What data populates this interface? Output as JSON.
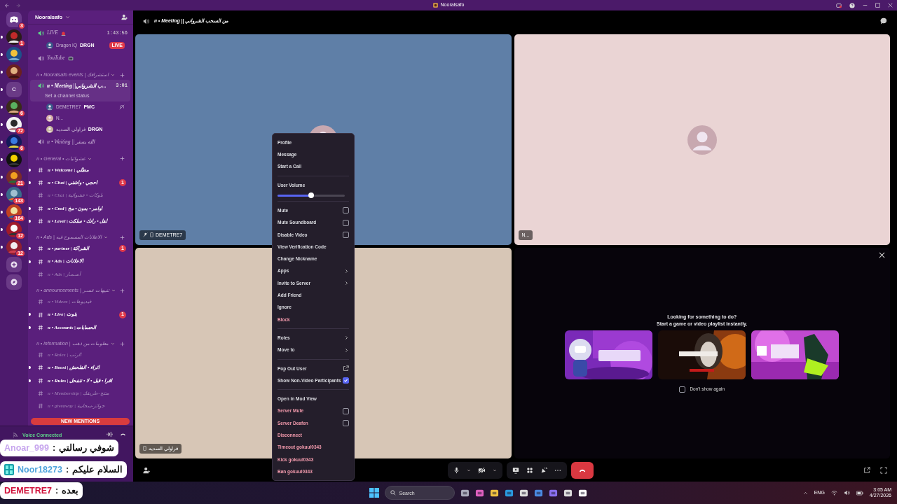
{
  "window": {
    "title": "Nooralsafo"
  },
  "servers": [
    {
      "kind": "home",
      "badge": "3",
      "unread": false
    },
    {
      "kind": "picture",
      "badge": "1",
      "unread": true
    },
    {
      "kind": "picture",
      "unread": true
    },
    {
      "kind": "picture",
      "unread": true
    },
    {
      "kind": "letter",
      "letter": "C",
      "unread": true
    },
    {
      "kind": "picture",
      "badge": "6",
      "unread": true
    },
    {
      "kind": "picture",
      "badge": "72",
      "unread": true
    },
    {
      "kind": "picture",
      "badge": "6",
      "unread": true
    },
    {
      "kind": "picture",
      "unread": true
    },
    {
      "kind": "picture",
      "badge": "21",
      "unread": true
    },
    {
      "kind": "picture",
      "badge": "143",
      "unread": true
    },
    {
      "kind": "picture",
      "badge": "164",
      "unread": true
    },
    {
      "kind": "picture",
      "badge": "12",
      "unread": true
    },
    {
      "kind": "picture",
      "badge": "12",
      "unread": true
    },
    {
      "kind": "add"
    },
    {
      "kind": "discover"
    }
  ],
  "sidebar": {
    "title": "Nooralsafo",
    "channels": [
      {
        "kind": "voice",
        "name": "LIVE",
        "active": true,
        "selected": false,
        "time": "1:43:56",
        "members": [
          {
            "name": "Dragon IQ",
            "tag": "DRGN",
            "live": "LIVE",
            "deafened": false
          }
        ]
      },
      {
        "kind": "voice",
        "name": "YouTube",
        "active": false,
        "selected": false
      },
      {
        "kind": "category",
        "name": "ıı • Nooralsafo events | استشراقك"
      },
      {
        "kind": "voice",
        "name": "ıı • Meeting ||ب الشرواني...",
        "active": true,
        "selected": true,
        "time": "3:01",
        "status": "Set a channel status",
        "members": [
          {
            "name": "DEMETRE7",
            "tag": "PMC",
            "deafened": true
          },
          {
            "name": "N...",
            "deafened": false
          },
          {
            "name": "فراولي السديه",
            "tag": "DRGN",
            "deafened": false
          }
        ]
      },
      {
        "kind": "voice",
        "name": "ıı • Waiting || الله يستر",
        "active": false,
        "selected": false
      },
      {
        "kind": "category",
        "name": "ıı • General • عشوائيات"
      },
      {
        "kind": "text",
        "name": "ıı • Welcome | مطلي",
        "unread": true,
        "selected": false
      },
      {
        "kind": "text",
        "name": "ıı • Chat | احجي • واشتي",
        "unread": true,
        "selected": false,
        "badge": "1"
      },
      {
        "kind": "text",
        "name": "ıı • Chat | بلوكات • عشوائية",
        "unread": false,
        "selected": false
      },
      {
        "kind": "text",
        "name": "ıı • Cmd | اوامر • بدون • مخ",
        "unread": true,
        "selected": false
      },
      {
        "kind": "text",
        "name": "ıı • Level | لفل • رانك • سلكت",
        "unread": true,
        "selected": false
      },
      {
        "kind": "category",
        "name": "ıı • Ads | الاعلانات المسموح فيه"
      },
      {
        "kind": "text",
        "name": "ıı • partner | الشراكة",
        "unread": true,
        "selected": false,
        "badge": "1"
      },
      {
        "kind": "text",
        "name": "ıı • Ads | الاعلانات",
        "unread": true,
        "selected": false
      },
      {
        "kind": "text",
        "name": "ıı • Ads | أسـمـار",
        "unread": false,
        "selected": false
      },
      {
        "kind": "category",
        "name": "ıı • announcements | تنبيهات عسـر"
      },
      {
        "kind": "text",
        "name": "ıı • Videos | فيديوهات",
        "unread": false,
        "selected": false
      },
      {
        "kind": "text",
        "name": "ıı • Live | بثوث",
        "unread": true,
        "selected": false,
        "badge": "1"
      },
      {
        "kind": "text",
        "name": "ıı • Accounts | الحسابات",
        "unread": true,
        "selected": false
      },
      {
        "kind": "category",
        "name": "ıı • information | معلومات من ذهب"
      },
      {
        "kind": "text",
        "name": "ıı • Roles | الرتب",
        "unread": false,
        "selected": false
      },
      {
        "kind": "text",
        "name": "ıı • Boost | اثراء • الفلحش",
        "unread": true,
        "selected": false
      },
      {
        "kind": "text",
        "name": "ıı • Rules | اقرا • قبل • لا • تتفحل",
        "unread": true,
        "selected": false
      },
      {
        "kind": "text",
        "name": "ıı • Membership | منتج-طريقك",
        "unread": false,
        "selected": false
      },
      {
        "kind": "text",
        "name": "ıı • giveaway | جوائز-سحابية",
        "unread": false,
        "selected": false
      }
    ],
    "new_mentions": "NEW MENTIONS"
  },
  "voice_panel": {
    "title": "Voice Connected"
  },
  "overlay_messages": [
    {
      "user": "Anoar_999",
      "separator": ":",
      "message": "شوفي رسالتي",
      "color": "#c7a6ee",
      "badge_icon": false
    },
    {
      "user": "Noor18273",
      "separator": ":",
      "message": "السلام عليكم",
      "color": "#4fa3dc",
      "badge_icon": true
    },
    {
      "user": "DEMETRE7",
      "separator": ":",
      "message": "بعده",
      "color": "#d0103a",
      "badge_icon": false
    }
  ],
  "topbar": {
    "channel": "ıı • Meeting || من السحب الشرواني"
  },
  "tiles": [
    {
      "kind": "video",
      "name": "DEMETRE7",
      "color": "#5f7fa7",
      "mobile": true,
      "muted": true
    },
    {
      "kind": "video",
      "name": "N...",
      "color": "#ead4d4",
      "mobile": false,
      "muted": false
    },
    {
      "kind": "video",
      "name": "فراولي السديه",
      "color": "#d7c6b6",
      "mobile": true,
      "muted": false
    },
    {
      "kind": "activity",
      "title": "Looking for something to do?",
      "subtitle": "Start a game or video playlist instantly.",
      "games": [
        {
          "kind": "picture"
        },
        {
          "kind": "picture"
        },
        {
          "kind": "picture"
        }
      ],
      "dont_show": {
        "label": "Don't show again",
        "checked": false
      }
    }
  ],
  "menu": {
    "sections": [
      {
        "items": [
          {
            "label": "Profile",
            "kind": "item",
            "danger": false
          },
          {
            "label": "Message",
            "kind": "item",
            "danger": false
          },
          {
            "label": "Start a Call",
            "kind": "item",
            "danger": false
          }
        ]
      },
      {
        "items": [
          {
            "label": "User Volume",
            "kind": "slider",
            "danger": false,
            "level": 0.5
          }
        ]
      },
      {
        "items": [
          {
            "label": "Mute",
            "kind": "checkbox",
            "danger": false,
            "checked": false
          },
          {
            "label": "Mute Soundboard",
            "kind": "checkbox",
            "danger": false,
            "checked": false
          },
          {
            "label": "Disable Video",
            "kind": "checkbox",
            "danger": false,
            "checked": false
          },
          {
            "label": "View Verification Code",
            "kind": "item",
            "danger": false
          },
          {
            "label": "Change Nickname",
            "kind": "item",
            "danger": false
          },
          {
            "label": "Apps",
            "kind": "submenu",
            "danger": false
          },
          {
            "label": "Invite to Server",
            "kind": "submenu",
            "danger": false
          },
          {
            "label": "Add Friend",
            "kind": "item",
            "danger": false
          },
          {
            "label": "Ignore",
            "kind": "item",
            "danger": false
          },
          {
            "label": "Block",
            "kind": "item",
            "danger": true
          }
        ]
      },
      {
        "items": [
          {
            "label": "Roles",
            "kind": "submenu",
            "danger": false
          },
          {
            "label": "Move to",
            "kind": "submenu",
            "danger": false
          }
        ]
      },
      {
        "items": [
          {
            "label": "Pop Out User",
            "kind": "popout",
            "danger": false
          },
          {
            "label": "Show Non-Video Participants",
            "kind": "checkbox",
            "danger": false,
            "checked": true
          }
        ]
      },
      {
        "items": [
          {
            "label": "Open in Mod View",
            "kind": "item",
            "danger": false
          },
          {
            "label": "Server Mute",
            "kind": "checkbox",
            "danger": true,
            "checked": false
          },
          {
            "label": "Server Deafen",
            "kind": "checkbox",
            "danger": true,
            "checked": false
          },
          {
            "label": "Disconnect",
            "kind": "item",
            "danger": true
          },
          {
            "label": "Timeout gokuul0343",
            "kind": "item",
            "danger": true
          },
          {
            "label": "Kick gokuul0343",
            "kind": "item",
            "danger": true
          },
          {
            "label": "Ban gokuul0343",
            "kind": "item",
            "danger": true
          }
        ]
      }
    ]
  },
  "controls": {
    "mic_on": true,
    "video_on": false
  },
  "taskbar": {
    "search_placeholder": "Search",
    "language": "ENG",
    "time": "3:05 AM",
    "date": "4/27/2026"
  }
}
